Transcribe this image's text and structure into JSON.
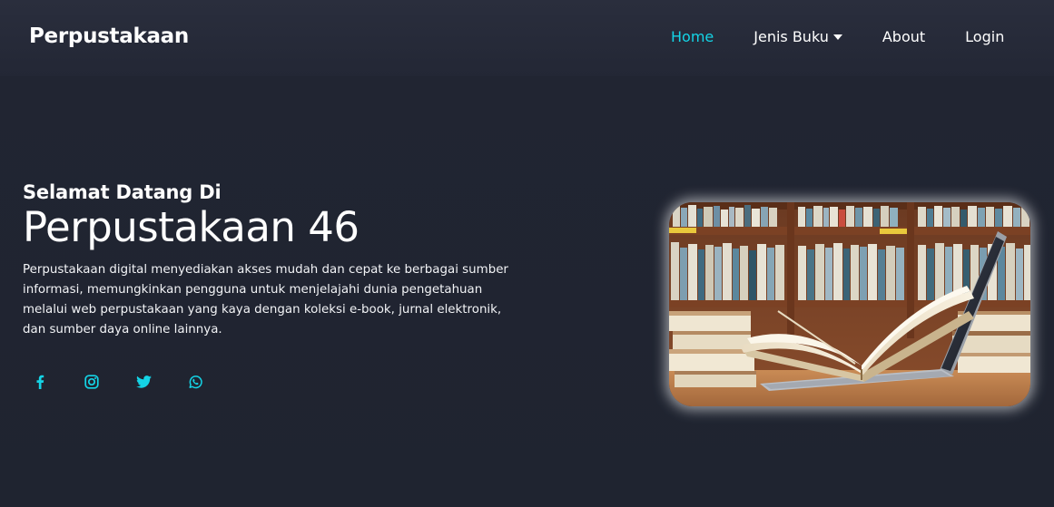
{
  "navbar": {
    "brand": "Perpustakaan",
    "links": [
      {
        "label": "Home",
        "active": true
      },
      {
        "label": "Jenis Buku",
        "has_dropdown": true
      },
      {
        "label": "About"
      },
      {
        "label": "Login"
      }
    ]
  },
  "hero": {
    "subtitle": "Selamat Datang Di",
    "title": "Perpustakaan 46",
    "description": "Perpustakaan digital menyediakan akses mudah dan cepat ke berbagai sumber informasi, memungkinkan pengguna untuk menjelajahi dunia pengetahuan melalui web perpustakaan yang kaya dengan koleksi e-book, jurnal elektronik, dan sumber daya online lainnya.",
    "socials": [
      {
        "icon": "facebook-icon"
      },
      {
        "icon": "instagram-icon"
      },
      {
        "icon": "twitter-icon"
      },
      {
        "icon": "whatsapp-icon"
      }
    ],
    "image": {
      "subject": "open book on laptop in front of library shelves"
    }
  },
  "colors": {
    "accent": "#14d4e6",
    "background": "#202430",
    "navbar": "#272b39",
    "text": "#ffffff"
  }
}
